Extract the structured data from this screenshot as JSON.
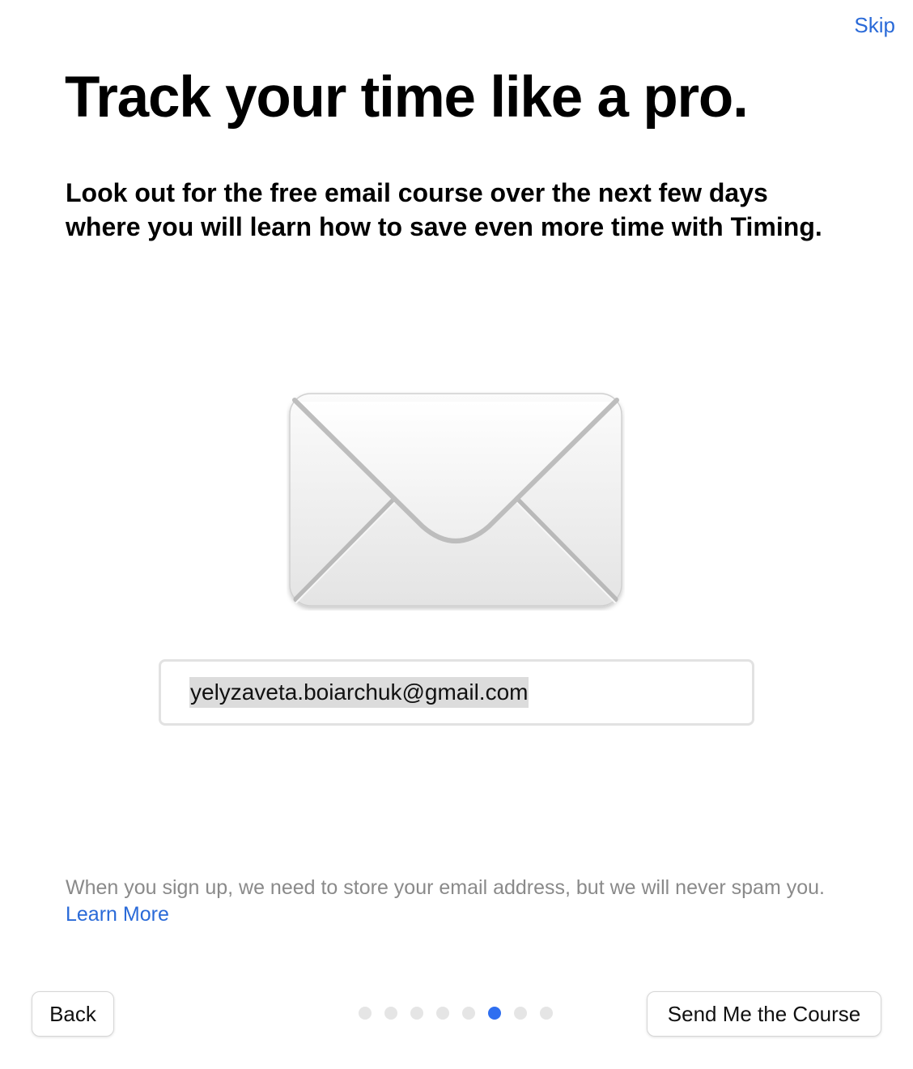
{
  "header": {
    "skip_label": "Skip"
  },
  "content": {
    "title": "Track your time like a pro.",
    "subtitle": "Look out for the free email course over the next few days where you will learn how to save even more time with Timing.",
    "illustration_icon": "envelope-icon"
  },
  "email": {
    "value": "yelyzaveta.boiarchuk@gmail.com"
  },
  "footer": {
    "disclaimer": "When you sign up, we need to store your email address, but we will never spam you.",
    "learn_more": "Learn More",
    "back_label": "Back",
    "send_label": "Send Me the Course"
  },
  "pager": {
    "total": 8,
    "active_index": 5
  },
  "colors": {
    "accent": "#2a6ad8",
    "active_dot": "#2f6ff0",
    "inactive_dot": "#e5e5e5"
  }
}
